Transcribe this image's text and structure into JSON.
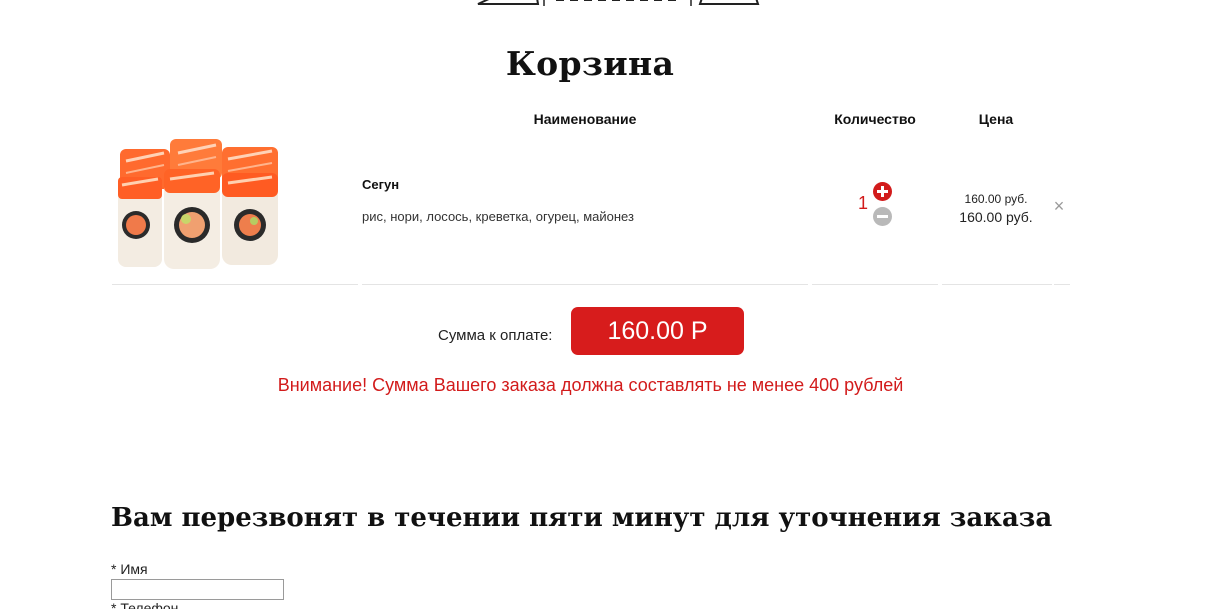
{
  "cart": {
    "title": "Корзина",
    "columns": {
      "name": "Наименование",
      "quantity": "Количество",
      "price": "Цена"
    },
    "items": [
      {
        "name": "Сегун",
        "description": "рис, нори, лосось, креветка, огурец, майонез",
        "quantity": "1",
        "unit_price": "160.00 руб.",
        "total_price": "160.00 руб.",
        "remove_symbol": "×",
        "image": "salmon-sushi-roll"
      }
    ],
    "sum_label": "Сумма к оплате:",
    "sum_value": "160.00 Р",
    "warning": "Внимание! Сумма Вашего заказа должна составлять не менее 400 рублей"
  },
  "callback_form": {
    "title": "Вам перезвонят в течении пяти минут для уточнения заказа",
    "name_label": "* Имя",
    "name_value": "",
    "phone_label": "* Телефон"
  },
  "colors": {
    "accent": "#d71c1c",
    "minus_button": "#b9b9b9",
    "divider": "#e4e4e4"
  }
}
